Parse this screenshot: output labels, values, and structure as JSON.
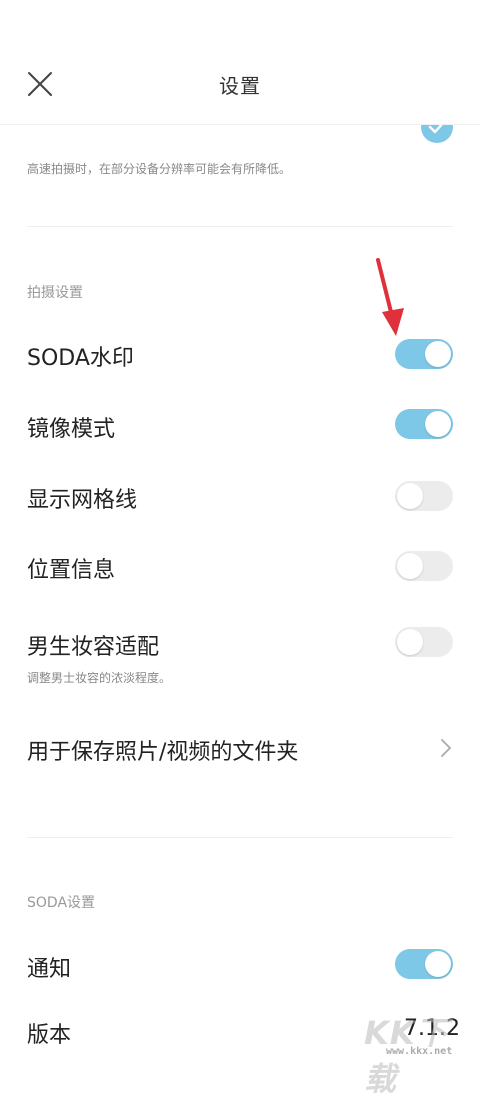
{
  "header": {
    "title": "设置",
    "close_icon": "close-icon"
  },
  "top_section": {
    "checkbox_icon": "check-circle-icon",
    "hint": "高速拍摄时，在部分设备分辨率可能会有所降低。"
  },
  "capture_settings": {
    "section_label": "拍摄设置",
    "items": [
      {
        "label": "SODA水印",
        "enabled": true
      },
      {
        "label": "镜像模式",
        "enabled": true
      },
      {
        "label": "显示网格线",
        "enabled": false
      },
      {
        "label": "位置信息",
        "enabled": false
      },
      {
        "label": "男生妆容适配",
        "enabled": false,
        "hint": "调整男士妆容的浓淡程度。"
      }
    ],
    "folder_label": "用于保存照片/视频的文件夹",
    "folder_icon": "chevron-right-icon"
  },
  "soda_settings": {
    "section_label": "SODA设置",
    "notify_label": "通知",
    "notify_enabled": true,
    "version_label": "版本",
    "version_value": "7.1.2"
  },
  "overlay": {
    "arrow_icon": "red-arrow-icon",
    "watermark_logo": "KK下载",
    "watermark_url": "www.kkx.net"
  },
  "colors": {
    "toggle_on": "#7ec8e7",
    "toggle_off": "#ececec",
    "arrow": "#e0303a"
  }
}
